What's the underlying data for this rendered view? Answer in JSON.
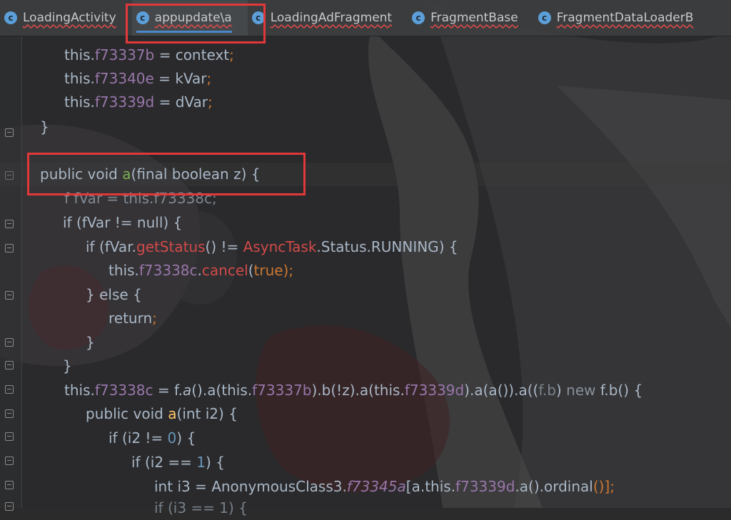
{
  "tabs": [
    {
      "label": "LoadingActivity",
      "icon": "class-c-icon",
      "active": false
    },
    {
      "label": "appupdate\\a",
      "icon": "class-c-icon",
      "active": true
    },
    {
      "label": "LoadingAdFragment",
      "icon": "class-c-icon",
      "active": false
    },
    {
      "label": "FragmentBase",
      "icon": "class-c-icon",
      "active": false
    },
    {
      "label": "FragmentDataLoaderB",
      "icon": "class-c-icon",
      "active": false
    }
  ],
  "code": {
    "lines": [
      [
        "this.",
        "f73337b",
        " = ",
        "context",
        ";"
      ],
      [
        "this.",
        "f73340e",
        " = ",
        "kVar",
        ";"
      ],
      [
        "this.",
        "f73339d",
        " = ",
        "dVar",
        ";"
      ],
      [
        "}"
      ],
      [
        "public ",
        "void ",
        "a",
        "(",
        "final ",
        "boolean ",
        "z",
        ") {"
      ],
      [
        "f fVar = this.f73338c;"
      ],
      [
        "if (",
        "fVar",
        " != ",
        "null",
        ") {"
      ],
      [
        "if (",
        "fVar",
        ".",
        "getStatus",
        "() != ",
        "AsyncTask",
        ".",
        "Status",
        ".",
        "RUNNING",
        ") {"
      ],
      [
        "this.",
        "f73338c",
        ".",
        "cancel",
        "(",
        "true",
        ");"
      ],
      [
        "} ",
        "else",
        " {"
      ],
      [
        "return",
        ";"
      ],
      [
        "}"
      ],
      [
        "}"
      ],
      [
        "this.",
        "f73338c",
        " = ",
        "f",
        ".",
        "a",
        "().",
        "a",
        "(",
        "this",
        ".",
        "f73337b",
        ").",
        "b",
        "(!",
        "z",
        ").",
        "a",
        "(",
        "this",
        ".",
        "f73339d",
        ").",
        "a",
        "(",
        "a",
        "()).",
        "a",
        "((",
        "f.b",
        ") ",
        "new ",
        "f.b",
        "() {"
      ],
      [
        "public ",
        "void ",
        "a",
        "(",
        "int ",
        "i2",
        ") {"
      ],
      [
        "if (",
        "i2",
        " != ",
        "0",
        ") {"
      ],
      [
        "if (",
        "i2",
        " == ",
        "1",
        ") {"
      ],
      [
        "int ",
        "i3",
        " = ",
        "AnonymousClass3",
        ".",
        "f73345a",
        "[",
        "a",
        ".",
        "this",
        ".",
        "f73339d",
        ".",
        "a",
        "().",
        "ordinal",
        "()];"
      ],
      [
        "if (i3 == 1) {"
      ]
    ]
  },
  "colors": {
    "keyword": "#cc7832",
    "field": "#9876aa",
    "text": "#a9b7c6",
    "highlight_box": "#e2383a",
    "tab_underline": "#4a88c7"
  }
}
